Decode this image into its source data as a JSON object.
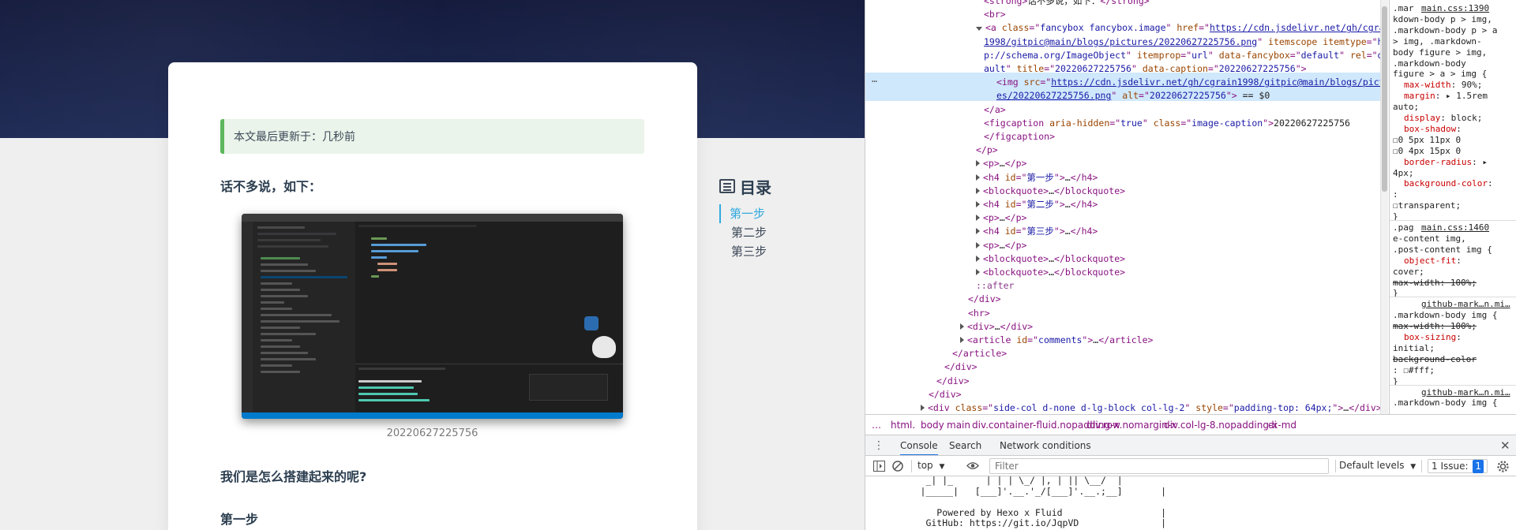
{
  "blog": {
    "note": "本文最后更新于：几秒前",
    "intro_heading": "话不多说，如下：",
    "image_caption": "20220627225756",
    "section_heading": "我们是怎么搭建起来的呢?",
    "step_heading": "第一步",
    "toc": {
      "title": "目录",
      "items": [
        {
          "label": "第一步",
          "active": true
        },
        {
          "label": "第二步",
          "active": false
        },
        {
          "label": "第三步",
          "active": false
        }
      ]
    }
  },
  "devtools": {
    "elements": {
      "lines": [
        {
          "segs": [
            [
              "tag",
              "<strong>"
            ],
            [
              "txt",
              "话不多说，如下："
            ],
            [
              "tag",
              "</strong>"
            ]
          ]
        },
        {
          "segs": [
            [
              "tag",
              "<br>"
            ]
          ]
        },
        {
          "tri": "down",
          "segs": [
            [
              "tag",
              "<a "
            ],
            [
              "attr",
              "class"
            ],
            [
              "tag",
              "=\""
            ],
            [
              "val",
              "fancybox fancybox.image"
            ],
            [
              "tag",
              "\" "
            ],
            [
              "attr",
              "href"
            ],
            [
              "tag",
              "=\""
            ],
            [
              "link",
              "https://cdn.jsdelivr.net/gh/cgrain"
            ]
          ]
        },
        {
          "segs": [
            [
              "link",
              "1998/gitpic@main/blogs/pictures/20220627225756.png"
            ],
            [
              "tag",
              "\" "
            ],
            [
              "attr",
              "itemscope itemtype"
            ],
            [
              "tag",
              "=\""
            ],
            [
              "val",
              "htt"
            ]
          ]
        },
        {
          "segs": [
            [
              "val",
              "p://schema.org/ImageObject"
            ],
            [
              "tag",
              "\" "
            ],
            [
              "attr",
              "itemprop"
            ],
            [
              "tag",
              "=\""
            ],
            [
              "val",
              "url"
            ],
            [
              "tag",
              "\" "
            ],
            [
              "attr",
              "data-fancybox"
            ],
            [
              "tag",
              "=\""
            ],
            [
              "val",
              "default"
            ],
            [
              "tag",
              "\" "
            ],
            [
              "attr",
              "rel"
            ],
            [
              "tag",
              "=\""
            ],
            [
              "val",
              "def"
            ]
          ]
        },
        {
          "segs": [
            [
              "val",
              "ault"
            ],
            [
              "tag",
              "\" "
            ],
            [
              "attr",
              "title"
            ],
            [
              "tag",
              "=\""
            ],
            [
              "val",
              "20220627225756"
            ],
            [
              "tag",
              "\" "
            ],
            [
              "attr",
              "data-caption"
            ],
            [
              "tag",
              "=\""
            ],
            [
              "val",
              "20220627225756"
            ],
            [
              "tag",
              "\">"
            ]
          ]
        },
        {
          "segs": [
            [
              "tag",
              "<img "
            ],
            [
              "attr",
              "src"
            ],
            [
              "tag",
              "=\""
            ],
            [
              "link",
              "https://cdn.jsdelivr.net/gh/cgrain1998/gitpic@main/blogs/pictur"
            ]
          ]
        },
        {
          "segs": [
            [
              "link",
              "es/20220627225756.png"
            ],
            [
              "tag",
              "\" "
            ],
            [
              "attr",
              "alt"
            ],
            [
              "tag",
              "=\""
            ],
            [
              "val",
              "20220627225756"
            ],
            [
              "tag",
              "\">"
            ],
            [
              "txt",
              " == $0"
            ]
          ]
        },
        {
          "segs": [
            [
              "tag",
              "</a>"
            ]
          ]
        },
        {
          "segs": [
            [
              "tag",
              "<figcaption "
            ],
            [
              "attr",
              "aria-hidden"
            ],
            [
              "tag",
              "=\""
            ],
            [
              "val",
              "true"
            ],
            [
              "tag",
              "\" "
            ],
            [
              "attr",
              "class"
            ],
            [
              "tag",
              "=\""
            ],
            [
              "val",
              "image-caption"
            ],
            [
              "tag",
              "\">"
            ],
            [
              "txt",
              "20220627225756"
            ]
          ]
        },
        {
          "segs": [
            [
              "tag",
              "</figcaption>"
            ]
          ]
        },
        {
          "segs": [
            [
              "tag",
              "</p>"
            ]
          ]
        },
        {
          "tri": "right",
          "segs": [
            [
              "tag",
              "<p>"
            ],
            [
              "txt",
              "…"
            ],
            [
              "tag",
              "</p>"
            ]
          ]
        },
        {
          "tri": "right",
          "segs": [
            [
              "tag",
              "<h4 "
            ],
            [
              "attr",
              "id"
            ],
            [
              "tag",
              "=\""
            ],
            [
              "val",
              "第一步"
            ],
            [
              "tag",
              "\">"
            ],
            [
              "txt",
              "…"
            ],
            [
              "tag",
              "</h4>"
            ]
          ]
        },
        {
          "tri": "right",
          "segs": [
            [
              "tag",
              "<blockquote>"
            ],
            [
              "txt",
              "…"
            ],
            [
              "tag",
              "</blockquote>"
            ]
          ]
        },
        {
          "tri": "right",
          "segs": [
            [
              "tag",
              "<h4 "
            ],
            [
              "attr",
              "id"
            ],
            [
              "tag",
              "=\""
            ],
            [
              "val",
              "第二步"
            ],
            [
              "tag",
              "\">"
            ],
            [
              "txt",
              "…"
            ],
            [
              "tag",
              "</h4>"
            ]
          ]
        },
        {
          "tri": "right",
          "segs": [
            [
              "tag",
              "<p>"
            ],
            [
              "txt",
              "…"
            ],
            [
              "tag",
              "</p>"
            ]
          ]
        },
        {
          "tri": "right",
          "segs": [
            [
              "tag",
              "<h4 "
            ],
            [
              "attr",
              "id"
            ],
            [
              "tag",
              "=\""
            ],
            [
              "val",
              "第三步"
            ],
            [
              "tag",
              "\">"
            ],
            [
              "txt",
              "…"
            ],
            [
              "tag",
              "</h4>"
            ]
          ]
        },
        {
          "tri": "right",
          "segs": [
            [
              "tag",
              "<p>"
            ],
            [
              "txt",
              "…"
            ],
            [
              "tag",
              "</p>"
            ]
          ]
        },
        {
          "tri": "right",
          "segs": [
            [
              "tag",
              "<blockquote>"
            ],
            [
              "txt",
              "…"
            ],
            [
              "tag",
              "</blockquote>"
            ]
          ]
        },
        {
          "tri": "right",
          "segs": [
            [
              "tag",
              "<blockquote>"
            ],
            [
              "txt",
              "…"
            ],
            [
              "tag",
              "</blockquote>"
            ]
          ]
        },
        {
          "segs": [
            [
              "pseudo",
              "::after"
            ]
          ]
        },
        {
          "segs": [
            [
              "tag",
              "</div>"
            ]
          ]
        },
        {
          "segs": [
            [
              "tag",
              "<hr>"
            ]
          ]
        },
        {
          "tri": "right",
          "segs": [
            [
              "tag",
              "<div>"
            ],
            [
              "txt",
              "…"
            ],
            [
              "tag",
              "</div>"
            ]
          ]
        },
        {
          "tri": "right",
          "segs": [
            [
              "tag",
              "<article "
            ],
            [
              "attr",
              "id"
            ],
            [
              "tag",
              "=\""
            ],
            [
              "val",
              "comments"
            ],
            [
              "tag",
              "\">"
            ],
            [
              "txt",
              "…"
            ],
            [
              "tag",
              "</article>"
            ]
          ]
        },
        {
          "segs": [
            [
              "tag",
              "</article>"
            ]
          ]
        },
        {
          "segs": [
            [
              "tag",
              "</div>"
            ]
          ]
        },
        {
          "segs": [
            [
              "tag",
              "</div>"
            ]
          ]
        },
        {
          "segs": [
            [
              "tag",
              "</div>"
            ]
          ]
        },
        {
          "tri": "right",
          "segs": [
            [
              "tag",
              "<div "
            ],
            [
              "attr",
              "class"
            ],
            [
              "tag",
              "=\""
            ],
            [
              "val",
              "side-col d-none d-lg-block col-lg-2"
            ],
            [
              "tag",
              "\" "
            ],
            [
              "attr",
              "style"
            ],
            [
              "tag",
              "=\""
            ],
            [
              "val",
              "padding-top: 64px;"
            ],
            [
              "tag",
              "\">"
            ],
            [
              "txt",
              "…"
            ],
            [
              "tag",
              "</div>"
            ]
          ]
        }
      ],
      "selected_dots": "…"
    },
    "breadcrumb": [
      "…",
      "html.",
      "body",
      "main",
      "div.container-fluid.nopadding-x",
      "div.row.nomargin-x",
      "div.col-lg-8.nopadding-x-md",
      "di"
    ],
    "styles": {
      "lines": [
        {
          "t": "sel",
          "text": ".mar",
          "src": "main.css:1390"
        },
        {
          "t": "plain",
          "text": "kdown-body p > img,"
        },
        {
          "t": "plain",
          "text": ".markdown-body p > a"
        },
        {
          "t": "plain",
          "text": "> img, .markdown-"
        },
        {
          "t": "plain",
          "text": "body figure > img,"
        },
        {
          "t": "plain",
          "text": ".markdown-body"
        },
        {
          "t": "plain",
          "text": "figure > a > img {"
        },
        {
          "t": "prop",
          "name": "max-width",
          "value": "90%;"
        },
        {
          "t": "prop",
          "name": "margin",
          "value": "▸ 1.5rem"
        },
        {
          "t": "plain",
          "text": "      auto;"
        },
        {
          "t": "prop",
          "name": "display",
          "value": "block;"
        },
        {
          "t": "prop",
          "name": "box-shadow",
          "value": ""
        },
        {
          "t": "plain",
          "text": "    ☐0 5px 11px 0"
        },
        {
          "t": "plain",
          "text": "    ☐0 4px 15px 0"
        },
        {
          "t": "prop",
          "name": "border-radius",
          "value": "▸"
        },
        {
          "t": "plain",
          "text": "    4px;"
        },
        {
          "t": "prop",
          "name": "background-color",
          "value": ""
        },
        {
          "t": "plain",
          "text": "    :"
        },
        {
          "t": "plain",
          "text": "  ☐transparent;"
        },
        {
          "t": "plain",
          "text": "}"
        },
        {
          "t": "sel",
          "text": ".pag",
          "src": "main.css:1460"
        },
        {
          "t": "plain",
          "text": "e-content img,"
        },
        {
          "t": "plain",
          "text": ".post-content img {"
        },
        {
          "t": "prop",
          "name": "object-fit",
          "value": ""
        },
        {
          "t": "plain",
          "text": "      cover;"
        },
        {
          "t": "strike",
          "text": "  max-width: 100%;"
        },
        {
          "t": "plain",
          "text": "}"
        },
        {
          "t": "sel",
          "text": "",
          "src": "github-mark…n.mi…"
        },
        {
          "t": "plain",
          "text": ".markdown-body img {"
        },
        {
          "t": "strike",
          "text": "  max-width: 100%;"
        },
        {
          "t": "prop",
          "name": "box-sizing",
          "value": ""
        },
        {
          "t": "plain",
          "text": "      initial;"
        },
        {
          "t": "strike",
          "text": "  background-color"
        },
        {
          "t": "plain",
          "text": "    : ☐#fff;"
        },
        {
          "t": "plain",
          "text": "}"
        },
        {
          "t": "sel",
          "text": "",
          "src": "github-mark…n.mi…"
        },
        {
          "t": "plain",
          "text": ".markdown-body img {"
        }
      ]
    },
    "drawer_tabs": [
      "Console",
      "Search",
      "Network conditions"
    ],
    "console_toolbar": {
      "context": "top",
      "filter_placeholder": "Filter",
      "levels": "Default levels",
      "issues": "1 Issue:",
      "issue_count": "1"
    },
    "console_lines": [
      "       _| |_      | | | \\_/ |, | || \\__/  |",
      "      |_____|   [___]'.__.'_/[___]'.__.;__]       |",
      "",
      "         Powered by Hexo x Fluid                  |",
      "       GitHub: https://git.io/JqpVD               |"
    ]
  },
  "colors": {
    "accent": "#30a9de",
    "note_border": "#5cb85c",
    "banner": "#1e2a55",
    "devtools_selected": "#cfe8fc"
  }
}
